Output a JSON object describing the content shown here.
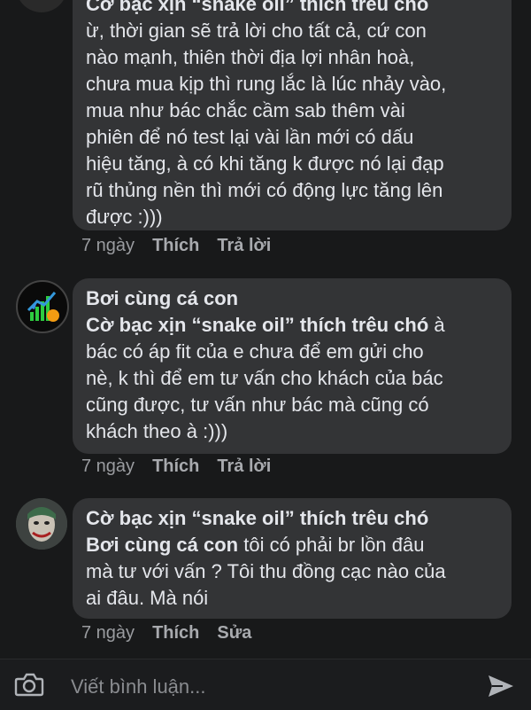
{
  "comments": [
    {
      "author": "Cờ bạc xịn “snake oil” thích trêu chó",
      "lines": [
        "ừ, thời gian sẽ trả lời cho tất cả, cứ con",
        "nào mạnh, thiên thời địa lợi nhân hoà,",
        "chưa mua kịp thì rung lắc là lúc nhảy vào,",
        "mua như bác chắc cầm sab thêm vài",
        "phiên để nó test lại vài lần mới có dấu",
        "hiệu tăng, à có khi tăng k được nó lại đạp",
        "rũ thủng nền thì mới có động lực tăng lên",
        "được :)))"
      ],
      "time": "7 ngày",
      "like": "Thích",
      "reply": "Trả lời"
    },
    {
      "author": "Bơi cùng cá con",
      "mention": "Cờ bạc xịn “snake oil” thích trêu chó",
      "mention_tail": " à",
      "lines": [
        "bác có áp fit của e chưa để em gửi cho",
        "nè, k thì để em tư vấn cho khách của bác",
        "cũng được, tư vấn như bác mà cũng có",
        "khách theo à :)))"
      ],
      "time": "7 ngày",
      "like": "Thích",
      "reply": "Trả lời"
    },
    {
      "author": "Cờ bạc xịn “snake oil” thích trêu chó",
      "mention": "Bơi cùng cá con",
      "mention_tail": "  tôi có phải br lồn đâu",
      "lines": [
        "mà tư với vấn ? Tôi thu đồng cạc nào của",
        "ai đâu. Mà nói"
      ],
      "time": "7 ngày",
      "like": "Thích",
      "edit": "Sửa"
    }
  ],
  "composer": {
    "placeholder": "Viết bình luận...",
    "camera_icon": "camera-icon",
    "send_icon": "send-icon"
  },
  "colors": {
    "background": "#18191a",
    "bubble": "#333436",
    "text": "#e4e6eb",
    "meta": "#9a9ca0"
  }
}
